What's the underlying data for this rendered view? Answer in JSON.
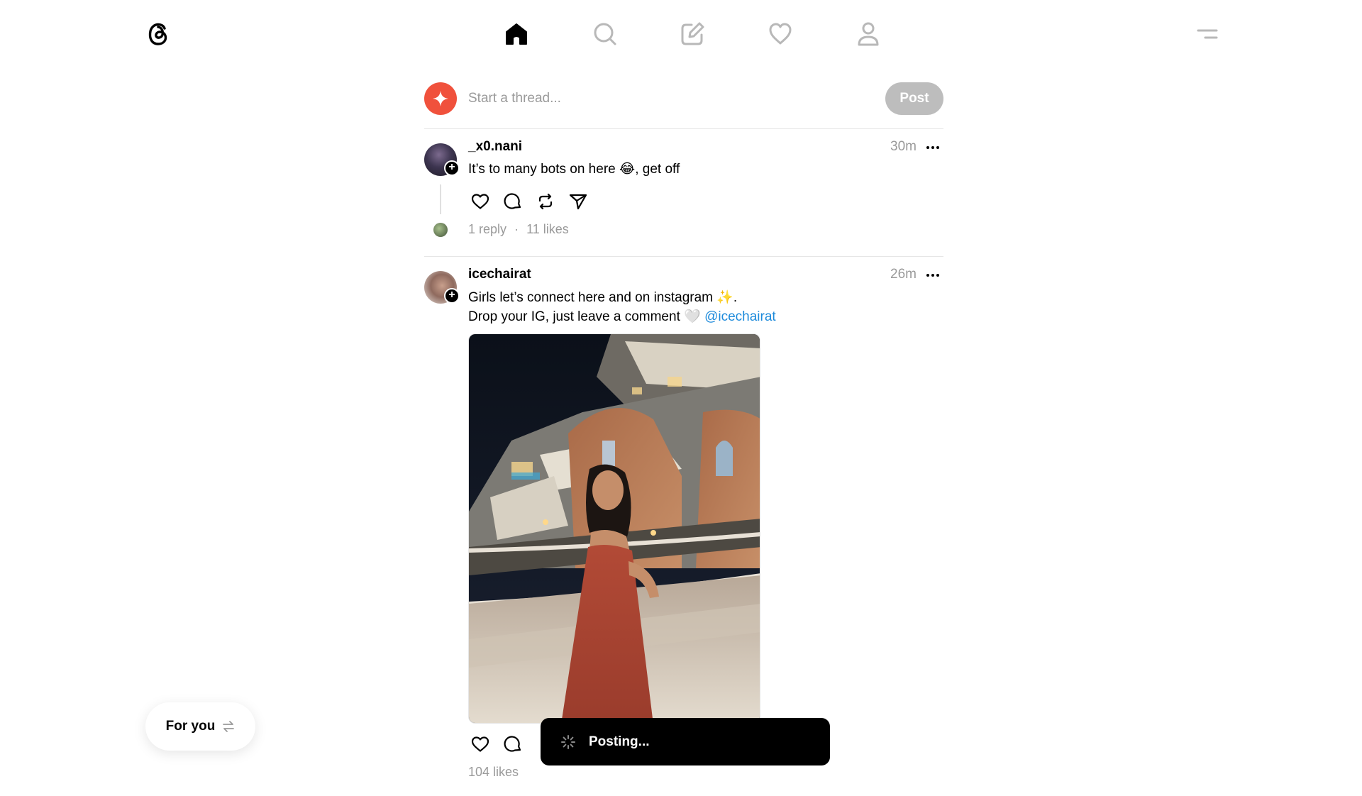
{
  "nav": {
    "items": [
      "home",
      "search",
      "create",
      "activity",
      "profile"
    ]
  },
  "composer": {
    "placeholder": "Start a thread...",
    "post_label": "Post"
  },
  "threads": [
    {
      "username": "_x0.nani",
      "time": "30m",
      "text": [
        "It’s to many bots on here 😂, get off"
      ],
      "replies": "1 reply",
      "separator": "·",
      "likes": "11 likes"
    },
    {
      "username": "icechairat",
      "time": "26m",
      "text_line1": "Girls let’s connect here and on instagram ✨.",
      "text_line2_prefix": "Drop your IG, just leave a comment 🤍 ",
      "mention": "@icechairat",
      "likes": "104 likes"
    }
  ],
  "for_you": {
    "label": "For you"
  },
  "toast": {
    "label": "Posting..."
  },
  "colors": {
    "accent_star": "#f0513c",
    "mention": "#1c8adb",
    "muted_text": "#9a9a9a"
  }
}
